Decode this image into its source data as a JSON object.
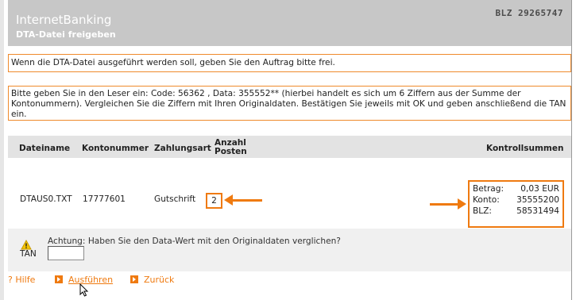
{
  "header": {
    "brand": "InternetBanking",
    "subtitle": "DTA-Datei freigeben",
    "blz": "BLZ 29265747"
  },
  "messages": {
    "release_notice": "Wenn die DTA-Datei ausgeführt werden soll, geben Sie den Auftrag bitte frei.",
    "reader_instruction": "Bitte geben Sie in den Leser ein: Code: 56362 , Data: 355552** (hierbei handelt es sich um 6 Ziffern aus der Summe der Kontonummern). Vergleichen Sie die Ziffern mit Ihren Originaldaten. Bestätigen Sie jeweils mit OK und geben anschließend die TAN ein."
  },
  "table": {
    "headers": {
      "filename": "Dateiname",
      "account": "Kontonummer",
      "payment_type": "Zahlungsart",
      "count_line1": "Anzahl",
      "count_line2": "Posten",
      "checksums": "Kontrollsummen"
    },
    "row": {
      "filename": "DTAUS0.TXT",
      "account": "17777601",
      "payment_type": "Gutschrift",
      "count": "2"
    },
    "checksums": [
      {
        "label": "Betrag:",
        "value": "0,03 EUR"
      },
      {
        "label": "Konto:",
        "value": "35555200"
      },
      {
        "label": "BLZ:",
        "value": "58531494"
      }
    ]
  },
  "warning": {
    "icon": "warning-icon",
    "text": "Achtung: Haben Sie den Data-Wert mit den Originaldaten verglichen?"
  },
  "tan": {
    "label": "TAN",
    "value": ""
  },
  "footer": {
    "help": "? Hilfe",
    "execute": "Ausführen",
    "back": "Zurück"
  },
  "colors": {
    "accent": "#ef7a10",
    "header_bg": "#c7c7c7",
    "table_header_bg": "#e3e3e3",
    "panel_bg": "#f0f0f0"
  }
}
